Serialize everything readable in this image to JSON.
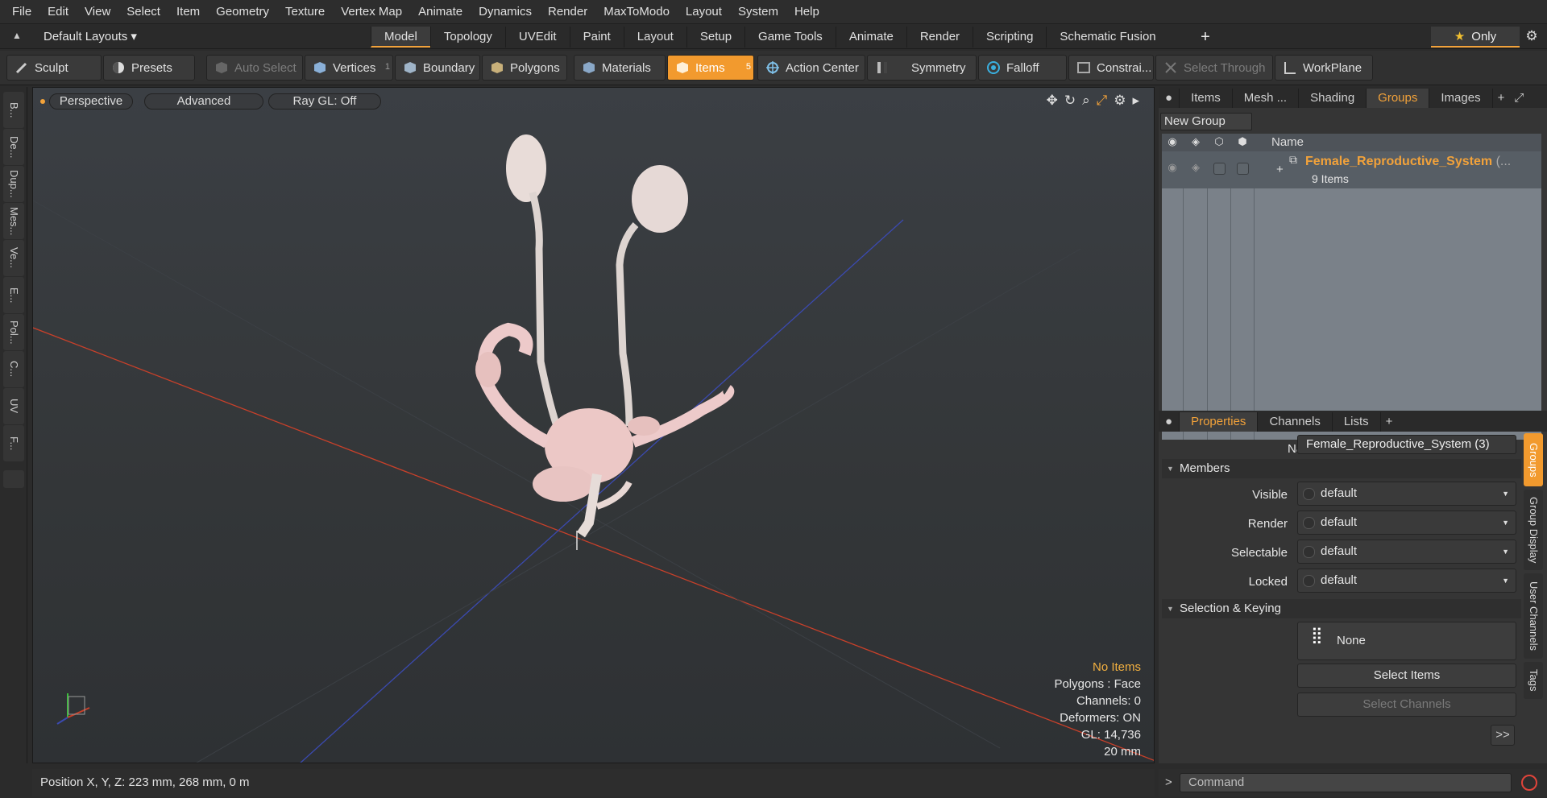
{
  "menu": [
    "File",
    "Edit",
    "View",
    "Select",
    "Item",
    "Geometry",
    "Texture",
    "Vertex Map",
    "Animate",
    "Dynamics",
    "Render",
    "MaxToModo",
    "Layout",
    "System",
    "Help"
  ],
  "layout_select": "Default Layouts ▾",
  "layout_tabs": [
    "Model",
    "Topology",
    "UVEdit",
    "Paint",
    "Layout",
    "Setup",
    "Game Tools",
    "Animate",
    "Render",
    "Scripting",
    "Schematic Fusion"
  ],
  "active_layout_tab": "Model",
  "add_tab": "+",
  "only_label": "Only",
  "toolbar": {
    "sculpt": "Sculpt",
    "presets": "Presets",
    "auto_select": "Auto Select",
    "vertices": "Vertices",
    "vertices_count": "1",
    "boundary": "Boundary",
    "polygons": "Polygons",
    "materials": "Materials",
    "items": "Items",
    "items_count": "5",
    "action_center": "Action Center",
    "symmetry": "Symmetry",
    "falloff": "Falloff",
    "constraints": "Constrai...",
    "select_through": "Select Through",
    "workplane": "WorkPlane"
  },
  "left_tools": [
    "B...",
    "De...",
    "Dup...",
    "Mes...",
    "Ve...",
    "E...",
    "Pol...",
    "C...",
    "UV",
    "F..."
  ],
  "viewport": {
    "perspective": "Perspective",
    "advanced": "Advanced",
    "raygl": "Ray GL: Off",
    "stats": [
      "No Items",
      "Polygons : Face",
      "Channels: 0",
      "Deformers: ON",
      "GL: 14,736",
      "20 mm"
    ]
  },
  "statusbar": "Position X, Y, Z:  223 mm, 268 mm, 0 m",
  "panel_tabs": [
    "Items",
    "Mesh ...",
    "Shading",
    "Groups",
    "Images"
  ],
  "active_panel_tab": "Groups",
  "new_group": "New Group",
  "groups_header_name": "Name",
  "group": {
    "name": "Female_Reproductive_System",
    "suffix": "(...",
    "count": "9 Items"
  },
  "props_tabs": [
    "Properties",
    "Channels",
    "Lists"
  ],
  "props": {
    "name_label": "Name",
    "name_value": "Female_Reproductive_System (3)",
    "members_section": "Members",
    "rows": [
      {
        "label": "Visible",
        "value": "default"
      },
      {
        "label": "Render",
        "value": "default"
      },
      {
        "label": "Selectable",
        "value": "default"
      },
      {
        "label": "Locked",
        "value": "default"
      }
    ],
    "selkey_section": "Selection & Keying",
    "none_label": "None",
    "select_items": "Select Items",
    "select_channels": "Select Channels",
    "more": ">>"
  },
  "side_tabs": [
    "Groups",
    "Group Display",
    "User Channels",
    "Tags"
  ],
  "command_placeholder": "Command",
  "colors": {
    "accent": "#f29a2e",
    "grid_x": "#c8402a",
    "grid_z": "#3b4ab0"
  }
}
